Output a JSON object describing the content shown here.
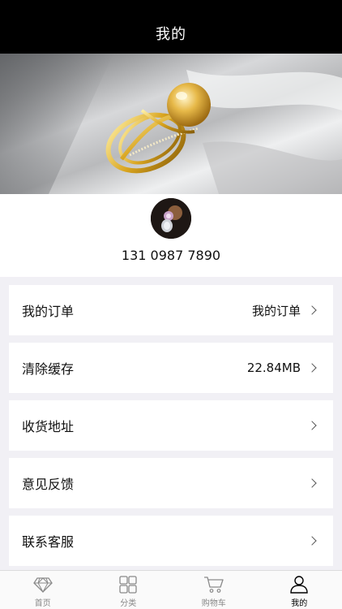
{
  "header": {
    "title": "我的"
  },
  "profile": {
    "phone": "131 0987 7890"
  },
  "menu": [
    {
      "label": "我的订单",
      "value": "我的订单"
    },
    {
      "label": "清除缓存",
      "value": "22.84MB"
    },
    {
      "label": "收货地址",
      "value": ""
    },
    {
      "label": "意见反馈",
      "value": ""
    },
    {
      "label": "联系客服",
      "value": ""
    }
  ],
  "tabbar": {
    "items": [
      {
        "label": "首页",
        "icon": "diamond-icon",
        "active": false
      },
      {
        "label": "分类",
        "icon": "grid-icon",
        "active": false
      },
      {
        "label": "购物车",
        "icon": "cart-icon",
        "active": false
      },
      {
        "label": "我的",
        "icon": "person-icon",
        "active": true
      }
    ]
  },
  "colors": {
    "navbar": "#000000",
    "background": "#f1f0f5",
    "tab_active": "#000000",
    "tab_inactive": "#888888"
  }
}
